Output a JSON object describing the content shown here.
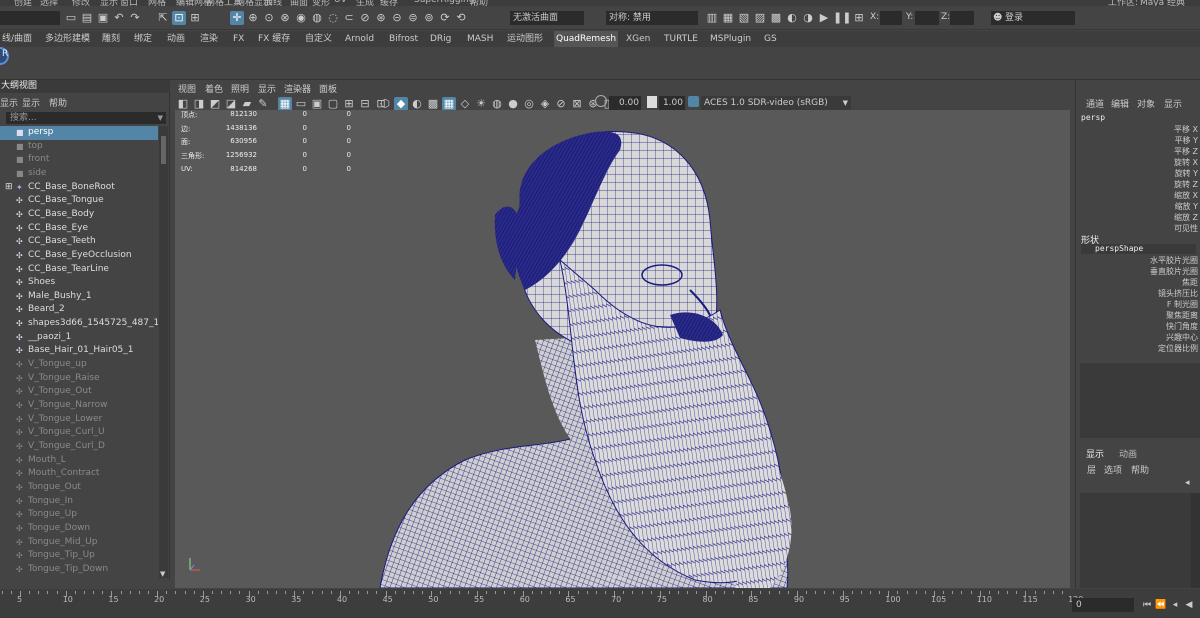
{
  "top_strip": {
    "items": [
      "创建",
      "选择",
      "修改",
      "显示",
      "窗口",
      "网格",
      "编辑网格",
      "网格工具",
      "网格显示",
      "曲线",
      "曲面",
      "变形",
      "UV",
      "生成",
      "缓存",
      "SuperRigging",
      "帮助"
    ],
    "workspace_label": "工作区:",
    "workspace_value": "Maya 经典"
  },
  "toolbar": {
    "mode_field": "",
    "live_surface": "无激活曲面",
    "symmetry": "对称: 禁用",
    "x_label": "X:",
    "y_label": "Y:",
    "z_label": "Z:",
    "login": "登录"
  },
  "shelf_tabs": [
    "线/曲面",
    "多边形建模",
    "雕刻",
    "绑定",
    "动画",
    "渲染",
    "FX",
    "FX 缓存",
    "自定义",
    "Arnold",
    "Bifrost",
    "DRig",
    "MASH",
    "运动图形",
    "QuadRemesh",
    "XGen",
    "TURTLE",
    "MSPlugin",
    "GS"
  ],
  "shelf_active": "QuadRemesh",
  "outliner": {
    "title": "大纲视图",
    "menu": [
      "显示",
      "显示",
      "帮助"
    ],
    "search_placeholder": "搜索...",
    "items": [
      {
        "label": "persp",
        "icon": "camera-icon",
        "state": "selected"
      },
      {
        "label": "top",
        "icon": "camera-icon",
        "state": "dim"
      },
      {
        "label": "front",
        "icon": "camera-icon",
        "state": "dim"
      },
      {
        "label": "side",
        "icon": "camera-icon",
        "state": "dim"
      },
      {
        "label": "CC_Base_BoneRoot",
        "icon": "joint-icon",
        "state": "normal"
      },
      {
        "label": "CC_Base_Tongue",
        "icon": "mesh-icon",
        "state": "normal"
      },
      {
        "label": "CC_Base_Body",
        "icon": "mesh-icon",
        "state": "normal"
      },
      {
        "label": "CC_Base_Eye",
        "icon": "mesh-icon",
        "state": "normal"
      },
      {
        "label": "CC_Base_Teeth",
        "icon": "mesh-icon",
        "state": "normal"
      },
      {
        "label": "CC_Base_EyeOcclusion",
        "icon": "mesh-icon",
        "state": "normal"
      },
      {
        "label": "CC_Base_TearLine",
        "icon": "mesh-icon",
        "state": "normal"
      },
      {
        "label": "Shoes",
        "icon": "mesh-icon",
        "state": "normal"
      },
      {
        "label": "Male_Bushy_1",
        "icon": "mesh-icon",
        "state": "normal"
      },
      {
        "label": "Beard_2",
        "icon": "mesh-icon",
        "state": "normal"
      },
      {
        "label": "shapes3d66_1545725_487_1",
        "icon": "mesh-icon",
        "state": "normal"
      },
      {
        "label": "__paozi_1",
        "icon": "mesh-icon",
        "state": "normal"
      },
      {
        "label": "Base_Hair_01_Hair05_1",
        "icon": "mesh-icon",
        "state": "normal"
      },
      {
        "label": "V_Tongue_up",
        "icon": "mesh-icon",
        "state": "dim"
      },
      {
        "label": "V_Tongue_Raise",
        "icon": "mesh-icon",
        "state": "dim"
      },
      {
        "label": "V_Tongue_Out",
        "icon": "mesh-icon",
        "state": "dim"
      },
      {
        "label": "V_Tongue_Narrow",
        "icon": "mesh-icon",
        "state": "dim"
      },
      {
        "label": "V_Tongue_Lower",
        "icon": "mesh-icon",
        "state": "dim"
      },
      {
        "label": "V_Tongue_Curl_U",
        "icon": "mesh-icon",
        "state": "dim"
      },
      {
        "label": "V_Tongue_Curl_D",
        "icon": "mesh-icon",
        "state": "dim"
      },
      {
        "label": "Mouth_L",
        "icon": "mesh-icon",
        "state": "dim"
      },
      {
        "label": "Mouth_Contract",
        "icon": "mesh-icon",
        "state": "dim"
      },
      {
        "label": "Tongue_Out",
        "icon": "mesh-icon",
        "state": "dim"
      },
      {
        "label": "Tongue_In",
        "icon": "mesh-icon",
        "state": "dim"
      },
      {
        "label": "Tongue_Up",
        "icon": "mesh-icon",
        "state": "dim"
      },
      {
        "label": "Tongue_Down",
        "icon": "mesh-icon",
        "state": "dim"
      },
      {
        "label": "Tongue_Mid_Up",
        "icon": "mesh-icon",
        "state": "dim"
      },
      {
        "label": "Tongue_Tip_Up",
        "icon": "mesh-icon",
        "state": "dim"
      },
      {
        "label": "Tongue_Tip_Down",
        "icon": "mesh-icon",
        "state": "dim"
      }
    ]
  },
  "viewport": {
    "menu": [
      "视图",
      "着色",
      "照明",
      "显示",
      "渲染器",
      "面板"
    ],
    "gamma": "0.00",
    "exposure": "1.00",
    "color_space": "ACES 1.0 SDR-video (sRGB)",
    "camera": "persp",
    "hud": [
      {
        "label": "顶点:",
        "v1": "812130",
        "v2": "0",
        "v3": "0"
      },
      {
        "label": "边:",
        "v1": "1438136",
        "v2": "0",
        "v3": "0"
      },
      {
        "label": "面:",
        "v1": "630956",
        "v2": "0",
        "v3": "0"
      },
      {
        "label": "三角形:",
        "v1": "1256932",
        "v2": "0",
        "v3": "0"
      },
      {
        "label": "UV:",
        "v1": "814268",
        "v2": "0",
        "v3": "0"
      }
    ]
  },
  "attributes": {
    "menu": [
      "通道",
      "编辑",
      "对象",
      "显示"
    ],
    "object": "persp",
    "channels": [
      "平移 X",
      "平移 Y",
      "平移 Z",
      "旋转 X",
      "旋转 Y",
      "旋转 Z",
      "缩放 X",
      "缩放 Y",
      "缩放 Z",
      "可见性"
    ],
    "shapes_header": "形状",
    "shape_name": "perspShape",
    "shape_attrs": [
      "水平胶片光圈",
      "垂直胶片光圈",
      "焦距",
      "镜头挤压比",
      "F 制光圈",
      "聚焦距离",
      "快门角度",
      "兴趣中心",
      "定位器比例"
    ]
  },
  "layers": {
    "tabs": [
      "显示",
      "动画"
    ],
    "menu": [
      "层",
      "选项",
      "帮助"
    ]
  },
  "timeline": {
    "ticks": [
      "5",
      "10",
      "15",
      "20",
      "25",
      "30",
      "35",
      "40",
      "45",
      "50",
      "55",
      "60",
      "65",
      "70",
      "75",
      "80",
      "85",
      "90",
      "95",
      "100",
      "105",
      "110",
      "115",
      "120"
    ],
    "current_frame": "0"
  },
  "colors": {
    "selection": "#5285a6",
    "wireframe": "#1a1a80",
    "mesh": "#d8d8d8",
    "viewport_bg": "#595959"
  }
}
